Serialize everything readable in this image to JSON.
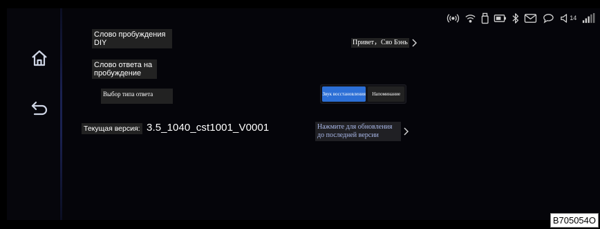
{
  "colors": {
    "accent": "#2c6fd6",
    "background": "#000000",
    "link_text": "#a9b8e8"
  },
  "sidebar": {
    "home_icon": "home-icon",
    "back_icon": "back-arrow-icon"
  },
  "status_bar": {
    "icons": [
      "hotspot-icon",
      "wifi-icon",
      "usb-icon",
      "battery-icon",
      "bluetooth-icon",
      "mail-icon",
      "chat-icon",
      "volume-icon",
      "signal-icon"
    ],
    "volume_level": "14"
  },
  "settings": {
    "wake_word_label": "Слово пробуждения DIY",
    "wake_word_value": "Привет，Сяо Бэнь",
    "response_word_label": "Слово ответа на пробуждение",
    "response_type_label": "Выбор типа ответа",
    "response_type_options": [
      "Звук восстановления",
      "Напоминание"
    ],
    "response_type_selected": "Звук восстановления",
    "version_label": "Текущая версия:",
    "version_value": "3.5_1040_cst1001_V0001",
    "update_link": "Нажмите для обновления до последней версии"
  },
  "code_badge": "B705054O"
}
